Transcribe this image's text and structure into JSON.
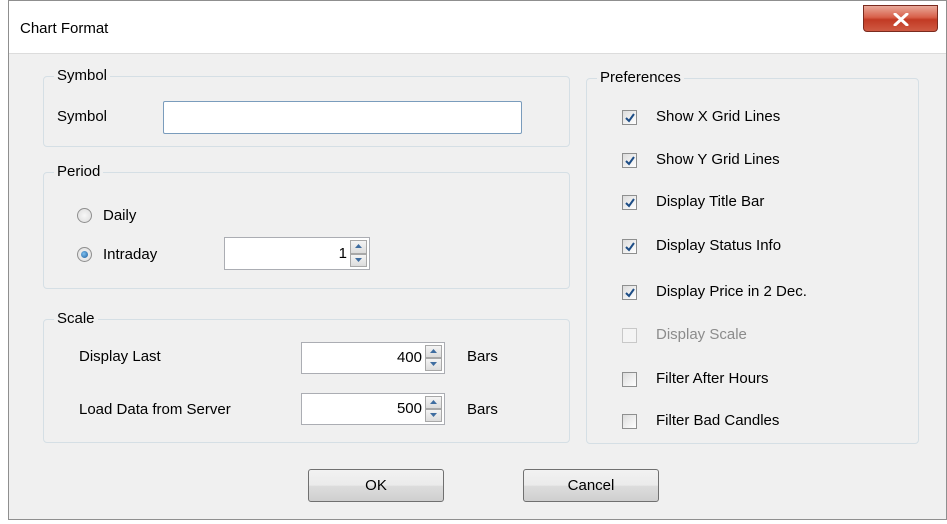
{
  "window": {
    "title": "Chart Format"
  },
  "symbol_group": {
    "legend": "Symbol",
    "label": "Symbol",
    "value": ""
  },
  "period_group": {
    "legend": "Period",
    "daily_label": "Daily",
    "intraday_label": "Intraday",
    "intraday_value": "1",
    "selected": "Intraday"
  },
  "scale_group": {
    "legend": "Scale",
    "display_last_label": "Display Last",
    "display_last_value": "400",
    "display_last_unit": "Bars",
    "load_data_label": "Load Data from Server",
    "load_data_value": "500",
    "load_data_unit": "Bars"
  },
  "preferences": {
    "legend": "Preferences",
    "items": [
      {
        "label": "Show X Grid Lines",
        "checked": true,
        "enabled": true
      },
      {
        "label": "Show Y Grid Lines",
        "checked": true,
        "enabled": true
      },
      {
        "label": "Display Title Bar",
        "checked": true,
        "enabled": true
      },
      {
        "label": "Display Status Info",
        "checked": true,
        "enabled": true
      },
      {
        "label": "Display Price in 2 Dec.",
        "checked": true,
        "enabled": true
      },
      {
        "label": "Display Scale",
        "checked": false,
        "enabled": false
      },
      {
        "label": "Filter After Hours",
        "checked": false,
        "enabled": true
      },
      {
        "label": "Filter Bad Candles",
        "checked": false,
        "enabled": true
      }
    ]
  },
  "buttons": {
    "ok": "OK",
    "cancel": "Cancel"
  },
  "colors": {
    "close_button": "#c9452e",
    "accent": "#1a5a9a",
    "checkmark": "#1d4d86"
  }
}
